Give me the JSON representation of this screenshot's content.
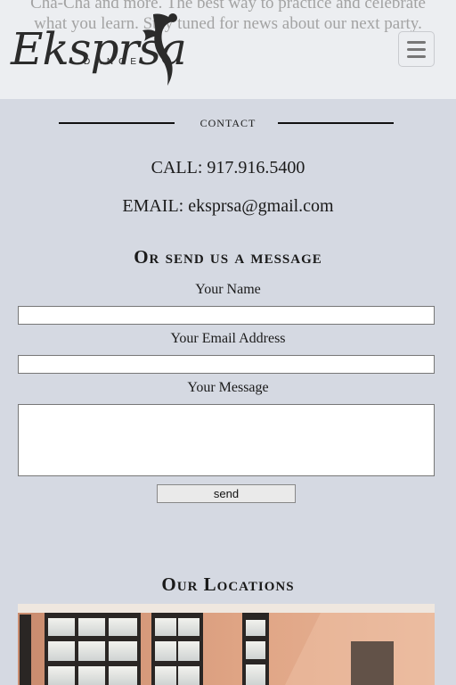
{
  "header": {
    "intro_text": "Cha-Cha and more. The best way to practice and celebrate what you learn. Stay tuned for news about our next party.",
    "logo_text": "Eksprsa",
    "logo_subtext": "DANCE",
    "menu_icon": "hamburger-menu-icon"
  },
  "contact": {
    "title": "contact",
    "call": "CALL: 917.916.5400",
    "email": "EMAIL: eksprsa@gmail.com"
  },
  "form": {
    "title": "Or send us a message",
    "name_label": "Your Name",
    "email_label": "Your Email Address",
    "message_label": "Your Message",
    "name_value": "",
    "email_value": "",
    "message_value": "",
    "send_label": "send"
  },
  "locations": {
    "title": "Our Locations",
    "image": "dance-studio-photo"
  }
}
